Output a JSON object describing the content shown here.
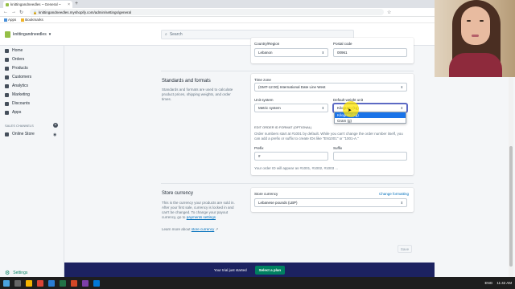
{
  "browser": {
    "tab_title": "knittingandneedles ~ General ~",
    "tab_close": "×",
    "new_tab": "+",
    "url": "knittingandneedles.myshopify.com/admin/settings/general",
    "bookmarks": [
      {
        "label": "Apps"
      },
      {
        "label": "Bookmarks"
      }
    ]
  },
  "topbar": {
    "store_name": "knittingandneedles",
    "search_placeholder": "Search"
  },
  "sidebar": {
    "items": [
      {
        "label": "Home",
        "icon": "home-icon"
      },
      {
        "label": "Orders",
        "icon": "orders-icon"
      },
      {
        "label": "Products",
        "icon": "products-icon"
      },
      {
        "label": "Customers",
        "icon": "customers-icon"
      },
      {
        "label": "Analytics",
        "icon": "analytics-icon"
      },
      {
        "label": "Marketing",
        "icon": "marketing-icon"
      },
      {
        "label": "Discounts",
        "icon": "discounts-icon"
      },
      {
        "label": "Apps",
        "icon": "apps-icon"
      }
    ],
    "sales_channels_label": "SALES CHANNELS",
    "online_store": "Online Store",
    "settings": "Settings"
  },
  "address": {
    "country_label": "Country/Region",
    "country_value": "Lebanon",
    "postal_label": "Postal code",
    "postal_value": "00961"
  },
  "standards": {
    "title": "Standards and formats",
    "description": "Standards and formats are used to calculate product prices, shipping weights, and order times.",
    "timezone_label": "Time zone",
    "timezone_value": "(GMT-12:00) International Date Line West",
    "unit_system_label": "Unit system",
    "unit_system_value": "Metric system",
    "weight_unit_label": "Default weight unit",
    "weight_options": [
      "Kilogram (kg)",
      "Gram (g)"
    ],
    "order_format_title": "EDIT ORDER ID FORMAT (OPTIONAL)",
    "order_format_desc": "Order numbers start at #1001 by default. While you can't change the order number itself, you can add a prefix or suffix to create IDs like \"EN1001\" or \"1001-A.\"",
    "prefix_label": "Prefix",
    "prefix_value": "#",
    "suffix_label": "Suffix",
    "suffix_value": "",
    "preview_text": "Your order ID will appear as #1001, #1002, #1003 ..."
  },
  "currency": {
    "title": "Store currency",
    "description_pre": "This is the currency your products are sold in. After your first sale, currency is locked in and can't be changed. To change your payout currency, go to ",
    "payments_link": "payments settings",
    "learn_pre": "Learn more about ",
    "learn_link": "store currency",
    "currency_label": "Store currency",
    "change_link": "Change formatting",
    "currency_value": "Lebanese pounds (LBP)"
  },
  "save_label": "Save",
  "trial": {
    "text": "Your trial just started",
    "button": "Select a plan"
  },
  "taskbar": {
    "lang": "ENG",
    "time": "11:42 AM"
  },
  "colors": {
    "accent": "#008060",
    "trial_bar": "#1c2260",
    "link": "#006fbb"
  }
}
